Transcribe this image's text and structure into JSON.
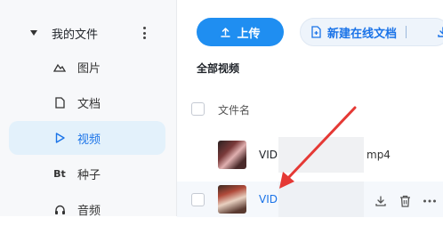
{
  "sidebar": {
    "group_label": "我的文件",
    "items": [
      {
        "label": "图片",
        "icon": "mountain-icon"
      },
      {
        "label": "文档",
        "icon": "document-icon"
      },
      {
        "label": "视频",
        "icon": "play-icon"
      },
      {
        "label": "种子",
        "icon": "bt-icon",
        "icon_text": "Bt"
      },
      {
        "label": "音频",
        "icon": "headphones-icon"
      }
    ],
    "active_item": "视频"
  },
  "toolbar": {
    "upload_label": "上传",
    "new_doc_label": "新建在线文档"
  },
  "main": {
    "section_title": "全部视频",
    "column_header": "文件名",
    "files": [
      {
        "name_prefix": "VID",
        "ext": "mp4"
      },
      {
        "name_prefix": "VID"
      }
    ]
  },
  "colors": {
    "accent": "#1f8ef1",
    "active_bg": "#e3f1fb",
    "annotation_arrow": "#e53935"
  }
}
